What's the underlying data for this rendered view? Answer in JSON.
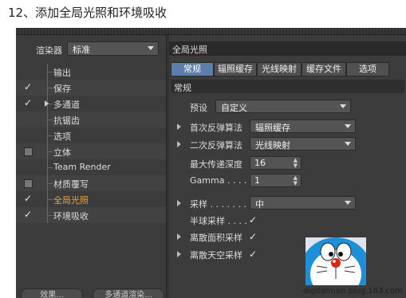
{
  "heading": "12、添加全局光照和环境吸收",
  "left_panel": {
    "renderer_label": "渲染器",
    "renderer_value": "标准",
    "tree": [
      {
        "label": "输出",
        "state": "none",
        "expand": false,
        "active": false
      },
      {
        "label": "保存",
        "state": "checked",
        "expand": false,
        "active": false
      },
      {
        "label": "多通道",
        "state": "checked",
        "expand": true,
        "active": false
      },
      {
        "label": "抗锯齿",
        "state": "none",
        "expand": false,
        "active": false
      },
      {
        "label": "选项",
        "state": "none",
        "expand": false,
        "active": false
      },
      {
        "label": "立体",
        "state": "unchecked",
        "expand": false,
        "active": false
      },
      {
        "label": "Team Render",
        "state": "none",
        "expand": false,
        "active": false
      },
      {
        "label": "材质覆写",
        "state": "unchecked",
        "expand": false,
        "active": false
      },
      {
        "label": "全局光照",
        "state": "checked",
        "expand": false,
        "active": true
      },
      {
        "label": "环境吸收",
        "state": "checked",
        "expand": false,
        "active": false
      }
    ],
    "buttons": {
      "effects": "效果...",
      "multipass": "多通道渲染..."
    }
  },
  "right_panel": {
    "title": "全局光照",
    "tabs": [
      "常规",
      "辐照缓存",
      "光线映射",
      "缓存文件",
      "选项"
    ],
    "active_tab": 0,
    "section": "常规",
    "preset_label": "预设",
    "preset_value": "自定义",
    "primary_label": "首次反弹算法",
    "primary_value": "辐照缓存",
    "secondary_label": "二次反弹算法",
    "secondary_value": "光线映射",
    "depth_label": "最大传递深度",
    "depth_value": "16",
    "gamma_label": "Gamma . . . .",
    "gamma_value": "1",
    "sample_label": "采样 . . . . . . .",
    "sample_value": "中",
    "hemi_label": "半球采样 . . . .",
    "discrete_area_label": "离散面积采样",
    "discrete_sky_label": "离散天空采样"
  },
  "check_glyph": "✓",
  "watermark": "digitalman.blog.163.com"
}
